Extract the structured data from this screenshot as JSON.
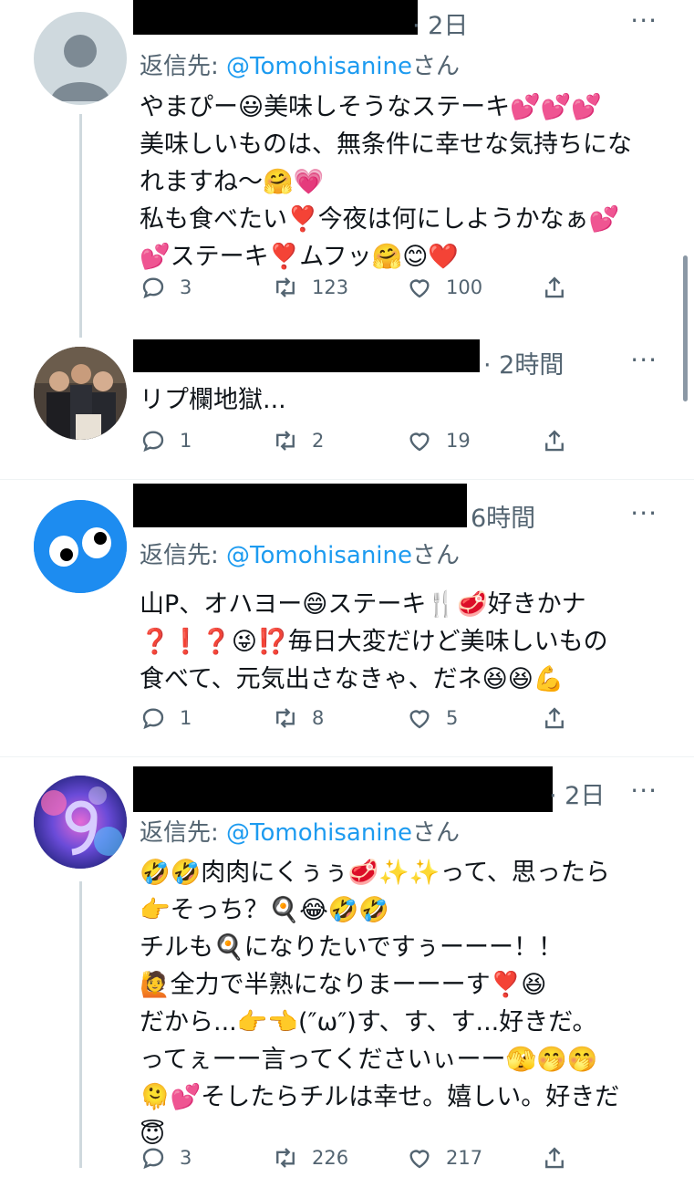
{
  "tweets": [
    {
      "time": "· 2日",
      "reply_prefix": "返信先: ",
      "reply_handle": "@Tomohisanine",
      "reply_suffix": "さん",
      "text": "やまぴー😃美味しそうなステーキ💕💕💕\n美味しいものは、無条件に幸せな気持ちにな\nれますね〜🤗💗\n私も食べたい❣️今夜は何にしようかなぁ💕\n💕ステーキ❣️ムフッ🤗😊❤️",
      "replies": "3",
      "retweets": "123",
      "likes": "100"
    },
    {
      "time": "· 2時間",
      "text": "リプ欄地獄...",
      "replies": "1",
      "retweets": "2",
      "likes": "19"
    },
    {
      "time": "6時間",
      "reply_prefix": "返信先: ",
      "reply_handle": "@Tomohisanine",
      "reply_suffix": "さん",
      "text": "山P、オハヨー😄ステーキ🍴🥩好きかナ\n❓❗❓😜⁉️毎日大変だけど美味しいもの\n食べて、元気出さなきゃ、だネ😆😆💪",
      "replies": "1",
      "retweets": "8",
      "likes": "5"
    },
    {
      "time": "· 2日",
      "reply_prefix": "返信先: ",
      "reply_handle": "@Tomohisanine",
      "reply_suffix": "さん",
      "text": "🤣🤣肉肉にくぅぅ🥩✨✨って、思ったら\n👉そっち？🍳😂🤣🤣\nチルも🍳になりたいですぅーーー！！\n🙋全力で半熟になりまーーーす❣️😆\nだから...👉👈(″ω″)す、す、す...好きだ。\nってぇーー言ってくださいぃーー🫣🤭🤭\n🫠💕そしたらチルは幸せ。嬉しい。好きだ\n😇",
      "replies": "3",
      "retweets": "226",
      "likes": "217"
    }
  ],
  "more_label": "···",
  "avatar_colors": {
    "default_bg": "#cfd9de",
    "default_fg": "#7d8a94",
    "cookie_bg": "#1d8cf0"
  }
}
